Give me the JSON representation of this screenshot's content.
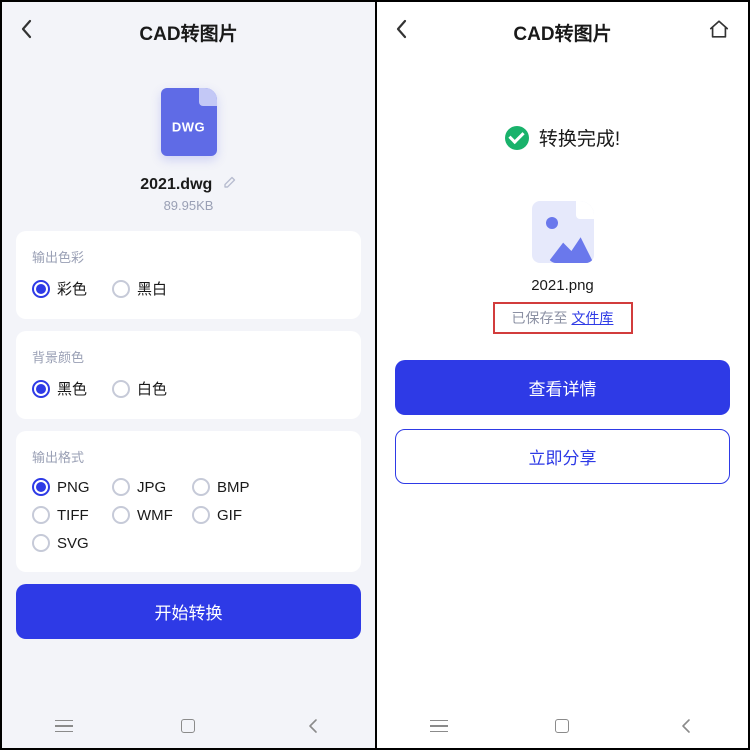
{
  "left": {
    "title": "CAD转图片",
    "file": {
      "icon_label": "DWG",
      "name": "2021.dwg",
      "size": "89.95KB"
    },
    "sections": {
      "color": {
        "label": "输出色彩",
        "options": [
          {
            "label": "彩色",
            "selected": true
          },
          {
            "label": "黑白",
            "selected": false
          }
        ]
      },
      "background": {
        "label": "背景颜色",
        "options": [
          {
            "label": "黑色",
            "selected": true
          },
          {
            "label": "白色",
            "selected": false
          }
        ]
      },
      "format": {
        "label": "输出格式",
        "options": [
          {
            "label": "PNG",
            "selected": true
          },
          {
            "label": "JPG",
            "selected": false
          },
          {
            "label": "BMP",
            "selected": false
          },
          {
            "label": "TIFF",
            "selected": false
          },
          {
            "label": "WMF",
            "selected": false
          },
          {
            "label": "GIF",
            "selected": false
          },
          {
            "label": "SVG",
            "selected": false
          }
        ]
      }
    },
    "start_button": "开始转换"
  },
  "right": {
    "title": "CAD转图片",
    "done_text": "转换完成!",
    "output_name": "2021.png",
    "saved_prefix": "已保存至 ",
    "saved_link": "文件库",
    "view_button": "查看详情",
    "share_button": "立即分享"
  }
}
